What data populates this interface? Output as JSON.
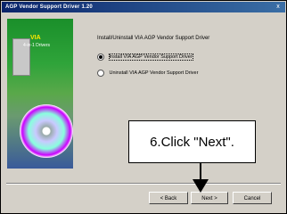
{
  "window": {
    "title": "AGP Vendor Support Driver 1.20",
    "close_glyph": "x"
  },
  "banner": {
    "line1": "VIA",
    "line2": "4-in-1 Drivers"
  },
  "content": {
    "heading": "Install/Uninstall VIA AGP Vendor Support Driver",
    "options": [
      {
        "label": "Install VIA AGP Vendor Support Driver",
        "selected": true
      },
      {
        "label": "Uninstall VIA AGP Vendor Support Driver",
        "selected": false
      }
    ]
  },
  "buttons": {
    "back": "< Back",
    "next": "Next >",
    "cancel": "Cancel"
  },
  "callout": {
    "text": "6.Click \"Next\"."
  },
  "colors": {
    "titlebar": "#0a246a",
    "dialog_bg": "#d4d0c8"
  }
}
